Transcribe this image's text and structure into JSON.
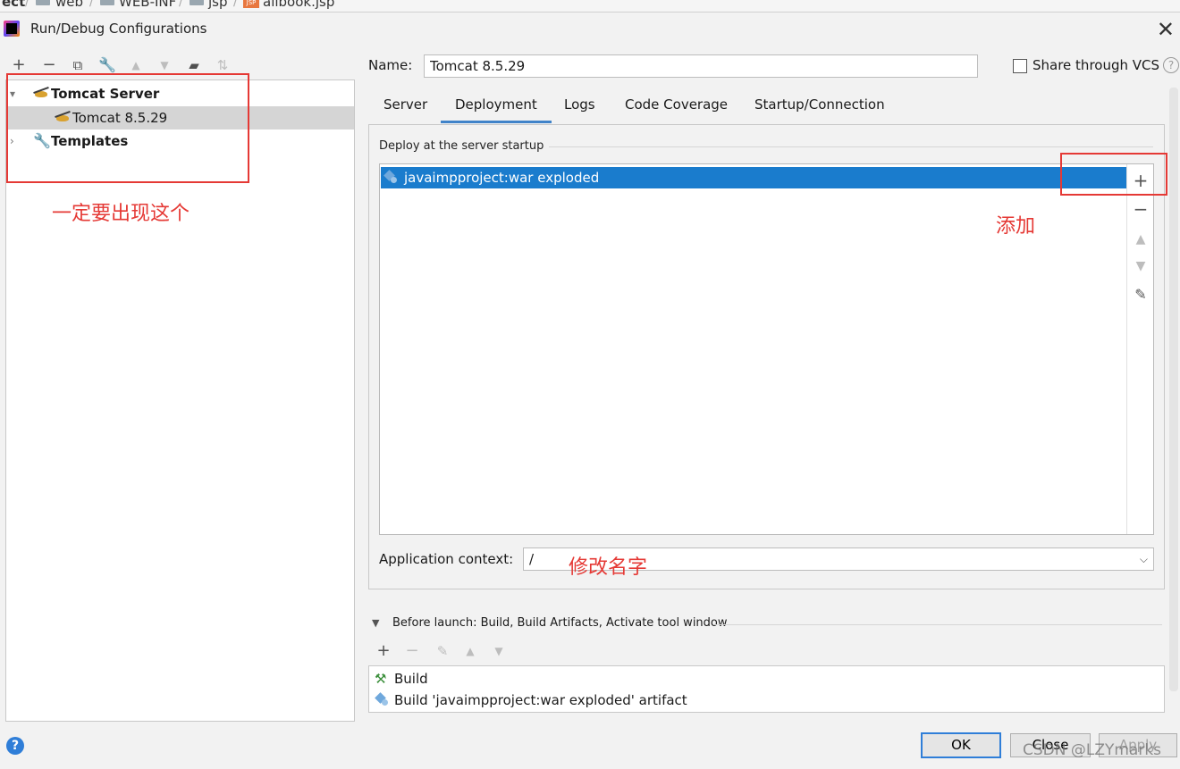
{
  "breadcrumbs": [
    {
      "label": "ect",
      "bold": true
    },
    {
      "label": "web"
    },
    {
      "label": "WEB-INF"
    },
    {
      "label": "jsp"
    },
    {
      "label": "allbook.jsp"
    }
  ],
  "window": {
    "title": "Run/Debug Configurations"
  },
  "left_toolbar": {
    "icons": [
      "add-icon",
      "remove-icon",
      "copy-icon",
      "wrench-icon",
      "move-up-icon",
      "move-down-icon",
      "new-folder-icon",
      "sort-icon"
    ]
  },
  "tree": {
    "tomcat_server": "Tomcat Server",
    "tomcat_child": "Tomcat 8.5.29",
    "templates": "Templates"
  },
  "annotations": {
    "tree_note": "一定要出现这个",
    "add_note": "添加",
    "context_note": "修改名字",
    "color": "#e53935"
  },
  "config": {
    "name_label": "Name:",
    "name_value": "Tomcat 8.5.29",
    "share_vcs_label": "Share through VCS",
    "share_vcs_checked": false
  },
  "tabs": [
    {
      "label": "Server",
      "active": false
    },
    {
      "label": "Deployment",
      "active": true
    },
    {
      "label": "Logs",
      "active": false
    },
    {
      "label": "Code Coverage",
      "active": false
    },
    {
      "label": "Startup/Connection",
      "active": false
    }
  ],
  "deployment": {
    "section_title": "Deploy at the server startup",
    "items": [
      "javaimpproject:war exploded"
    ],
    "selected_color": "#1a7ccd",
    "context_label": "Application context:",
    "context_value": "/"
  },
  "before_launch": {
    "label": "Before launch: Build, Build Artifacts, Activate tool window",
    "items": [
      "Build",
      "Build 'javaimpproject:war exploded' artifact"
    ]
  },
  "buttons": {
    "ok": "OK",
    "close": "Close",
    "apply": "Apply"
  },
  "watermark": "CSDN @LZYmarks"
}
